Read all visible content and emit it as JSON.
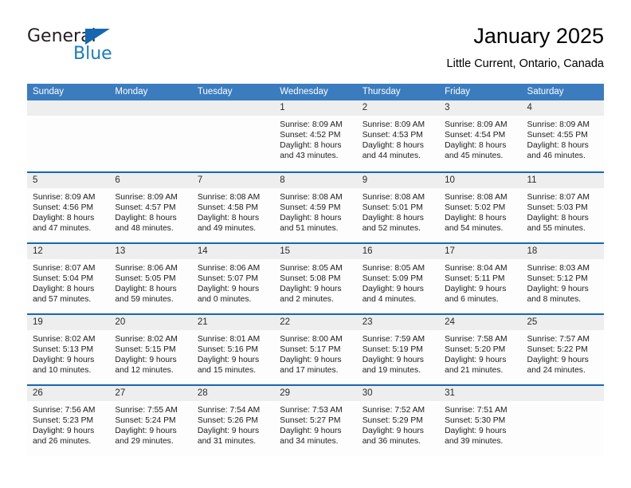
{
  "brand": {
    "name_top": "General",
    "name_bottom": "Blue",
    "triangle_icon": "triangle-icon",
    "color_dark": "#231f20",
    "color_blue": "#1a7bc6"
  },
  "header": {
    "title": "January 2025",
    "subtitle": "Little Current, Ontario, Canada"
  },
  "theme": {
    "header_bar": "#3b7cbf",
    "row_divider": "#1667b2",
    "cell_head": "#eeeeee"
  },
  "calendar": {
    "weekdays": [
      "Sunday",
      "Monday",
      "Tuesday",
      "Wednesday",
      "Thursday",
      "Friday",
      "Saturday"
    ],
    "weeks": [
      [
        {
          "day": "",
          "lines": []
        },
        {
          "day": "",
          "lines": []
        },
        {
          "day": "",
          "lines": []
        },
        {
          "day": "1",
          "lines": [
            "Sunrise: 8:09 AM",
            "Sunset: 4:52 PM",
            "Daylight: 8 hours",
            "and 43 minutes."
          ]
        },
        {
          "day": "2",
          "lines": [
            "Sunrise: 8:09 AM",
            "Sunset: 4:53 PM",
            "Daylight: 8 hours",
            "and 44 minutes."
          ]
        },
        {
          "day": "3",
          "lines": [
            "Sunrise: 8:09 AM",
            "Sunset: 4:54 PM",
            "Daylight: 8 hours",
            "and 45 minutes."
          ]
        },
        {
          "day": "4",
          "lines": [
            "Sunrise: 8:09 AM",
            "Sunset: 4:55 PM",
            "Daylight: 8 hours",
            "and 46 minutes."
          ]
        }
      ],
      [
        {
          "day": "5",
          "lines": [
            "Sunrise: 8:09 AM",
            "Sunset: 4:56 PM",
            "Daylight: 8 hours",
            "and 47 minutes."
          ]
        },
        {
          "day": "6",
          "lines": [
            "Sunrise: 8:09 AM",
            "Sunset: 4:57 PM",
            "Daylight: 8 hours",
            "and 48 minutes."
          ]
        },
        {
          "day": "7",
          "lines": [
            "Sunrise: 8:08 AM",
            "Sunset: 4:58 PM",
            "Daylight: 8 hours",
            "and 49 minutes."
          ]
        },
        {
          "day": "8",
          "lines": [
            "Sunrise: 8:08 AM",
            "Sunset: 4:59 PM",
            "Daylight: 8 hours",
            "and 51 minutes."
          ]
        },
        {
          "day": "9",
          "lines": [
            "Sunrise: 8:08 AM",
            "Sunset: 5:01 PM",
            "Daylight: 8 hours",
            "and 52 minutes."
          ]
        },
        {
          "day": "10",
          "lines": [
            "Sunrise: 8:08 AM",
            "Sunset: 5:02 PM",
            "Daylight: 8 hours",
            "and 54 minutes."
          ]
        },
        {
          "day": "11",
          "lines": [
            "Sunrise: 8:07 AM",
            "Sunset: 5:03 PM",
            "Daylight: 8 hours",
            "and 55 minutes."
          ]
        }
      ],
      [
        {
          "day": "12",
          "lines": [
            "Sunrise: 8:07 AM",
            "Sunset: 5:04 PM",
            "Daylight: 8 hours",
            "and 57 minutes."
          ]
        },
        {
          "day": "13",
          "lines": [
            "Sunrise: 8:06 AM",
            "Sunset: 5:05 PM",
            "Daylight: 8 hours",
            "and 59 minutes."
          ]
        },
        {
          "day": "14",
          "lines": [
            "Sunrise: 8:06 AM",
            "Sunset: 5:07 PM",
            "Daylight: 9 hours",
            "and 0 minutes."
          ]
        },
        {
          "day": "15",
          "lines": [
            "Sunrise: 8:05 AM",
            "Sunset: 5:08 PM",
            "Daylight: 9 hours",
            "and 2 minutes."
          ]
        },
        {
          "day": "16",
          "lines": [
            "Sunrise: 8:05 AM",
            "Sunset: 5:09 PM",
            "Daylight: 9 hours",
            "and 4 minutes."
          ]
        },
        {
          "day": "17",
          "lines": [
            "Sunrise: 8:04 AM",
            "Sunset: 5:11 PM",
            "Daylight: 9 hours",
            "and 6 minutes."
          ]
        },
        {
          "day": "18",
          "lines": [
            "Sunrise: 8:03 AM",
            "Sunset: 5:12 PM",
            "Daylight: 9 hours",
            "and 8 minutes."
          ]
        }
      ],
      [
        {
          "day": "19",
          "lines": [
            "Sunrise: 8:02 AM",
            "Sunset: 5:13 PM",
            "Daylight: 9 hours",
            "and 10 minutes."
          ]
        },
        {
          "day": "20",
          "lines": [
            "Sunrise: 8:02 AM",
            "Sunset: 5:15 PM",
            "Daylight: 9 hours",
            "and 12 minutes."
          ]
        },
        {
          "day": "21",
          "lines": [
            "Sunrise: 8:01 AM",
            "Sunset: 5:16 PM",
            "Daylight: 9 hours",
            "and 15 minutes."
          ]
        },
        {
          "day": "22",
          "lines": [
            "Sunrise: 8:00 AM",
            "Sunset: 5:17 PM",
            "Daylight: 9 hours",
            "and 17 minutes."
          ]
        },
        {
          "day": "23",
          "lines": [
            "Sunrise: 7:59 AM",
            "Sunset: 5:19 PM",
            "Daylight: 9 hours",
            "and 19 minutes."
          ]
        },
        {
          "day": "24",
          "lines": [
            "Sunrise: 7:58 AM",
            "Sunset: 5:20 PM",
            "Daylight: 9 hours",
            "and 21 minutes."
          ]
        },
        {
          "day": "25",
          "lines": [
            "Sunrise: 7:57 AM",
            "Sunset: 5:22 PM",
            "Daylight: 9 hours",
            "and 24 minutes."
          ]
        }
      ],
      [
        {
          "day": "26",
          "lines": [
            "Sunrise: 7:56 AM",
            "Sunset: 5:23 PM",
            "Daylight: 9 hours",
            "and 26 minutes."
          ]
        },
        {
          "day": "27",
          "lines": [
            "Sunrise: 7:55 AM",
            "Sunset: 5:24 PM",
            "Daylight: 9 hours",
            "and 29 minutes."
          ]
        },
        {
          "day": "28",
          "lines": [
            "Sunrise: 7:54 AM",
            "Sunset: 5:26 PM",
            "Daylight: 9 hours",
            "and 31 minutes."
          ]
        },
        {
          "day": "29",
          "lines": [
            "Sunrise: 7:53 AM",
            "Sunset: 5:27 PM",
            "Daylight: 9 hours",
            "and 34 minutes."
          ]
        },
        {
          "day": "30",
          "lines": [
            "Sunrise: 7:52 AM",
            "Sunset: 5:29 PM",
            "Daylight: 9 hours",
            "and 36 minutes."
          ]
        },
        {
          "day": "31",
          "lines": [
            "Sunrise: 7:51 AM",
            "Sunset: 5:30 PM",
            "Daylight: 9 hours",
            "and 39 minutes."
          ]
        },
        {
          "day": "",
          "lines": []
        }
      ]
    ]
  }
}
